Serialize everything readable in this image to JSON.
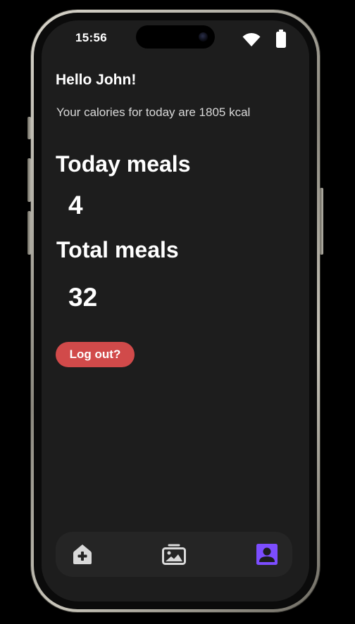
{
  "status_bar": {
    "time": "15:56"
  },
  "home": {
    "greeting": "Hello John!",
    "calories_text": "Your calories for today are 1805 kcal",
    "today_meals_title": "Today meals",
    "today_meals_value": "4",
    "total_meals_title": "Total meals",
    "total_meals_value": "32",
    "logout_label": "Log out?"
  },
  "bottom_nav": {
    "items": [
      {
        "icon": "add-meal-icon",
        "active": false
      },
      {
        "icon": "gallery-icon",
        "active": false
      },
      {
        "icon": "profile-icon",
        "active": true
      }
    ]
  },
  "colors": {
    "background": "#000000",
    "screen": "#1d1d1d",
    "nav_bar": "#252525",
    "logout": "#d14a4a",
    "active_nav": "#7c4dff",
    "inactive_nav": "#d9d9d9"
  }
}
